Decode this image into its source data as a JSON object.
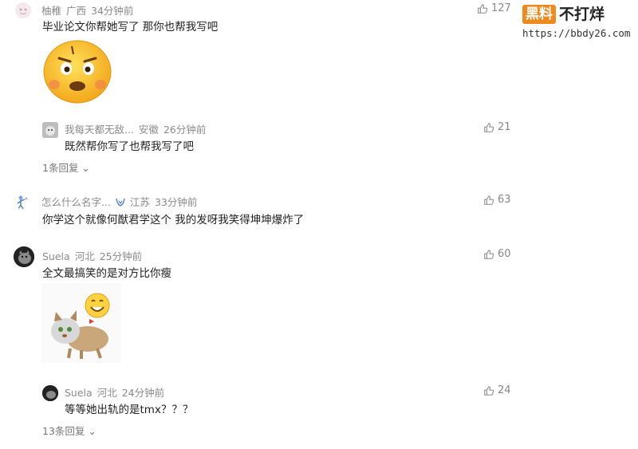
{
  "watermark": {
    "badge": "黑料",
    "text": "不打烊",
    "url": "https://bbdy26.com"
  },
  "comments": [
    {
      "name": "柚稚",
      "location": "广西",
      "time": "34分钟前",
      "likes": "127",
      "text": "毕业论文你帮她写了 那你也帮我写吧",
      "reply": {
        "name": "我每天都无敌...",
        "location": "安徽",
        "time": "26分钟前",
        "likes": "21",
        "text": "既然帮你写了也帮我写了吧"
      },
      "reply_count": "1条回复"
    },
    {
      "name": "怎么什么名字...",
      "location": "江苏",
      "time": "33分钟前",
      "likes": "63",
      "text": "你学这个就像何猷君学这个 我的发呀我笑得坤坤爆炸了"
    },
    {
      "name": "Suela",
      "location": "河北",
      "time": "25分钟前",
      "likes": "60",
      "text": "全文最搞笑的是对方比你瘦",
      "reply": {
        "name": "Suela",
        "location": "河北",
        "time": "24分钟前",
        "likes": "24",
        "text": "等等她出轨的是tmx？？？"
      },
      "reply_count": "13条回复"
    }
  ]
}
